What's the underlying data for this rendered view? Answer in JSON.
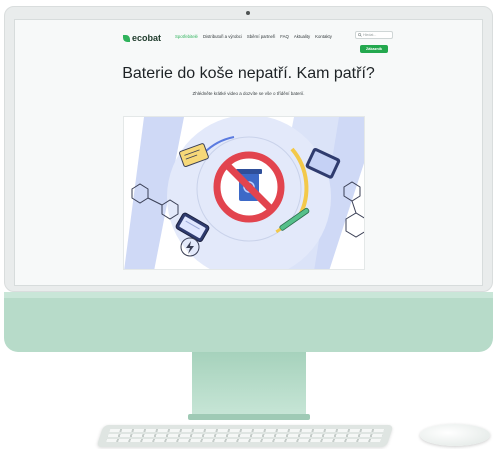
{
  "website": {
    "logo": "ecobat",
    "nav": [
      "Spotřebitelé",
      "Distributoři a výrobci",
      "Sběrní partneři",
      "FAQ",
      "Aktuality",
      "Kontakty"
    ],
    "search_placeholder": "Hledat...",
    "cta_button": "Zákazník",
    "headline": "Baterie do koše nepatří. Kam patří?",
    "subheadline": "Zhlédněte krátké video a dozvíte se vše o třídění baterií."
  },
  "colors": {
    "brand_green": "#2fb35c",
    "button_green": "#23a84e",
    "monitor_green": "#b7dbc9",
    "prohibition_red": "#e2444e",
    "illustration_blue": "#cfd9f6"
  },
  "icons": [
    "leaf-icon",
    "search-icon",
    "prohibition-icon",
    "trash-bin-icon",
    "battery-icon",
    "lightning-icon"
  ]
}
